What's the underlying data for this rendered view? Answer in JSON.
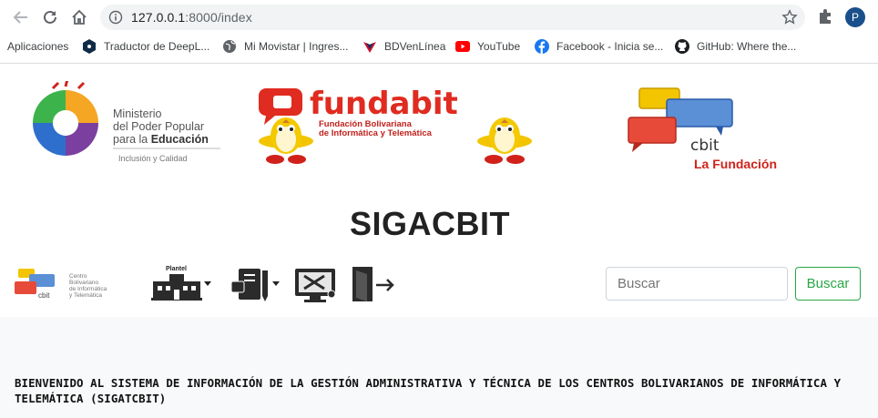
{
  "browser": {
    "url_host": "127.0.0.1",
    "url_port_path": ":8000/index",
    "profile_initial": "P",
    "bookmarks": [
      {
        "label": "Aplicaciones",
        "icon": "apps-grid-icon"
      },
      {
        "label": "Traductor de DeepL...",
        "icon": "deepl-icon"
      },
      {
        "label": "Mi Movistar | Ingres...",
        "icon": "globe-icon"
      },
      {
        "label": "BDVenLínea",
        "icon": "bdv-icon"
      },
      {
        "label": "YouTube",
        "icon": "youtube-icon"
      },
      {
        "label": "Facebook - Inicia se...",
        "icon": "facebook-icon"
      },
      {
        "label": "GitHub: Where the...",
        "icon": "github-icon"
      }
    ]
  },
  "logos": {
    "ministerio": {
      "line1": "Ministerio",
      "line2": "del Poder Popular",
      "line3_prefix": "para la ",
      "line3_bold": "Educación",
      "tagline": "Inclusión y Calidad"
    },
    "fundabit": {
      "name": "fundabit",
      "sub1": "Fundación Bolivariana",
      "sub2": "de Informática y Telemática"
    },
    "cbit": {
      "name": "cbit",
      "tagline": "La Fundación"
    }
  },
  "page": {
    "title": "SIGACBIT",
    "toolbar": {
      "cbit_small_lines": [
        "Centro",
        "Bolivariano",
        "de Informática",
        "y Telemática"
      ],
      "plantel_label": "Plantel",
      "search_placeholder": "Buscar",
      "search_button": "Buscar"
    },
    "welcome_text": "BIENVENIDO AL SISTEMA DE INFORMACIÓN DE LA GESTIÓN ADMINISTRATIVA Y TÉCNICA DE LOS CENTROS BOLIVARIANOS DE INFORMÁTICA Y TELEMÁTICA (SIGATCBIT)"
  },
  "colors": {
    "accent_green": "#28a745",
    "fundabit_red": "#e02b20",
    "cbit_red": "#d0221b"
  }
}
